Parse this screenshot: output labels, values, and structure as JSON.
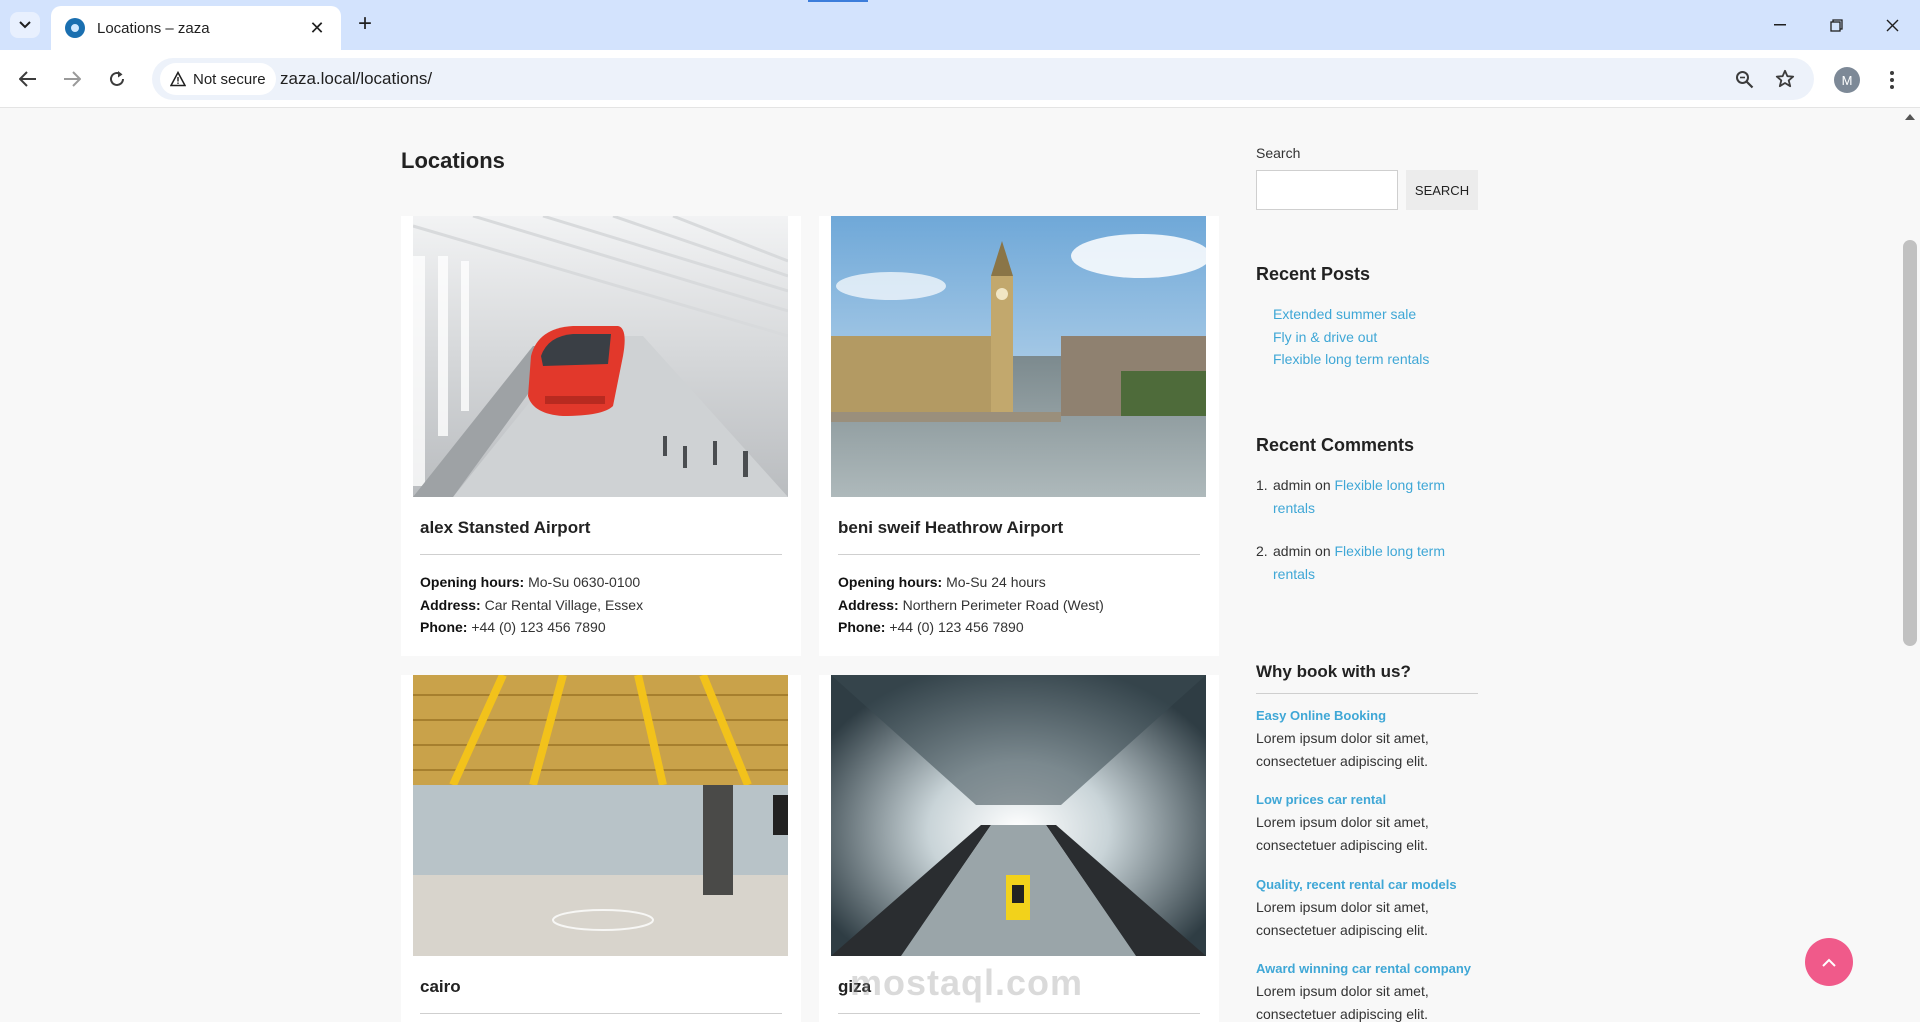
{
  "browser": {
    "tab_title": "Locations – zaza",
    "security_label": "Not secure",
    "url": "zaza.local/locations/",
    "profile_initial": "M"
  },
  "page": {
    "title": "Locations"
  },
  "locations": [
    {
      "name": "alex Stansted Airport",
      "hours_label": "Opening hours:",
      "hours": "Mo-Su 0630-0100",
      "address_label": "Address:",
      "address": "Car Rental Village, Essex",
      "phone_label": "Phone:",
      "phone": "+44 (0) 123 456 7890"
    },
    {
      "name": "beni sweif Heathrow Airport",
      "hours_label": "Opening hours:",
      "hours": "Mo-Su 24 hours",
      "address_label": "Address:",
      "address": "Northern Perimeter Road (West)",
      "phone_label": "Phone:",
      "phone": "+44 (0) 123 456 7890"
    },
    {
      "name": "cairo"
    },
    {
      "name": "giza"
    }
  ],
  "sidebar": {
    "search_label": "Search",
    "search_value": "",
    "search_button": "SEARCH",
    "recent_posts_title": "Recent Posts",
    "recent_posts": [
      "Extended summer sale",
      "Fly in & drive out",
      "Flexible long term rentals"
    ],
    "recent_comments_title": "Recent Comments",
    "comments": [
      {
        "num": "1.",
        "author": "admin",
        "on": "on",
        "post": "Flexible long term rentals"
      },
      {
        "num": "2.",
        "author": "admin",
        "on": "on",
        "post": "Flexible long term rentals"
      }
    ],
    "why_title": "Why book with us?",
    "features": [
      {
        "title": "Easy Online Booking",
        "text": "Lorem ipsum dolor sit amet, consectetuer adipiscing elit."
      },
      {
        "title": "Low prices car rental",
        "text": "Lorem ipsum dolor sit amet, consectetuer adipiscing elit."
      },
      {
        "title": "Quality, recent rental car models",
        "text": "Lorem ipsum dolor sit amet, consectetuer adipiscing elit."
      },
      {
        "title": "Award winning car rental company",
        "text": "Lorem ipsum dolor sit amet, consectetuer adipiscing elit."
      }
    ]
  },
  "watermark": "mostaql.com",
  "colors": {
    "accent_link": "#3fa7d6",
    "back_to_top": "#f05a8a",
    "tab_strip": "#d3e3fd"
  }
}
